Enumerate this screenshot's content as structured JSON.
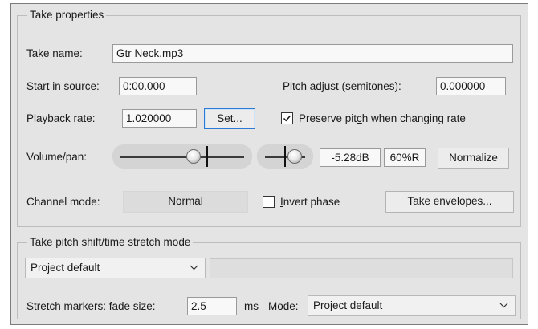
{
  "take_properties": {
    "legend": "Take properties",
    "take_name_label": "Take name:",
    "take_name_value": "Gtr Neck.mp3",
    "start_in_source_label": "Start in source:",
    "start_in_source_value": "0:00.000",
    "pitch_adjust_label": "Pitch adjust (semitones):",
    "pitch_adjust_value": "0.000000",
    "playback_rate_label": "Playback rate:",
    "playback_rate_value": "1.020000",
    "set_button": "Set...",
    "preserve_pitch_checked": true,
    "preserve_pitch_label_pre": "Preserve pit",
    "preserve_pitch_label_ul": "c",
    "preserve_pitch_label_post": "h when changing rate",
    "volume_pan_label": "Volume/pan:",
    "volume_db": "-5.28dB",
    "pan_value": "60%R",
    "normalize_button": "Normalize",
    "channel_mode_label": "Channel mode:",
    "channel_mode_value": "Normal",
    "invert_phase_checked": false,
    "invert_phase_label_ul": "I",
    "invert_phase_label_post": "nvert phase",
    "take_envelopes_button": "Take envelopes..."
  },
  "pitch_shift": {
    "legend": "Take pitch shift/time stretch mode",
    "mode_select": "Project default",
    "stretch_markers_label": "Stretch markers: fade size:",
    "fade_size_value": "2.5",
    "ms_label": "ms",
    "mode_label": "Mode:",
    "mode_value": "Project default"
  },
  "icons": {
    "checkmark": "check-icon",
    "chevron": "chevron-down-icon"
  }
}
